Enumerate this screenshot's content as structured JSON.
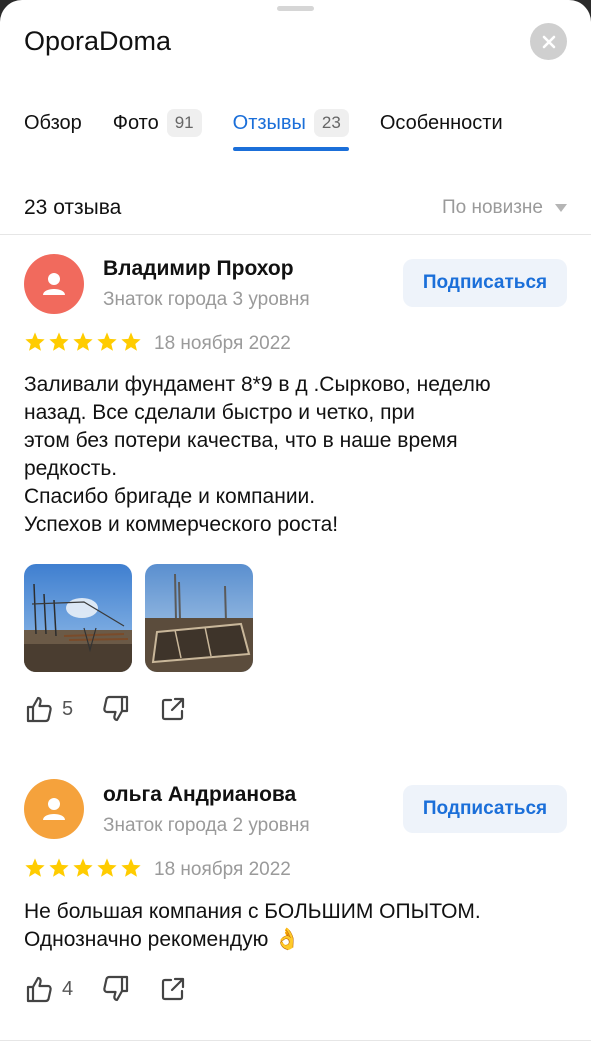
{
  "header": {
    "title": "OporaDoma",
    "close_icon": "close-icon"
  },
  "tabs": [
    {
      "label": "Обзор",
      "count": ""
    },
    {
      "label": "Фото",
      "count": "91"
    },
    {
      "label": "Отзывы",
      "count": "23",
      "active": true
    },
    {
      "label": "Особенности",
      "count": ""
    }
  ],
  "reviews_summary": {
    "count_label": "23 отзыва",
    "sort_label": "По новизне"
  },
  "colors": {
    "accent": "#1b6fd9",
    "star": "#ffcc00",
    "avatar_red": "#f16a5d",
    "avatar_orange": "#f5a23c"
  },
  "reviews": [
    {
      "author": "Владимир Прохор",
      "level": "Знаток города 3 уровня",
      "subscribe_label": "Подписаться",
      "rating": 5,
      "date": "18 ноября 2022",
      "text": "Заливали фундамент 8*9 в д .Сырково, неделю\nназад. Все сделали быстро и четко, при\nэтом без потери качества, что в наше время\nредкость.\nСпасибо бригаде и компании.\nУспехов и коммерческого роста!",
      "photos": [
        "foundation-rebar-photo",
        "foundation-formwork-photo"
      ],
      "likes": "5"
    },
    {
      "author": "ольга Андрианова",
      "level": "Знаток города 2 уровня",
      "subscribe_label": "Подписаться",
      "rating": 5,
      "date": "18 ноября 2022",
      "text": "Не большая компания с БОЛЬШИМ ОПЫТОМ.\nОднозначно рекомендую 👌",
      "likes": "4"
    }
  ]
}
